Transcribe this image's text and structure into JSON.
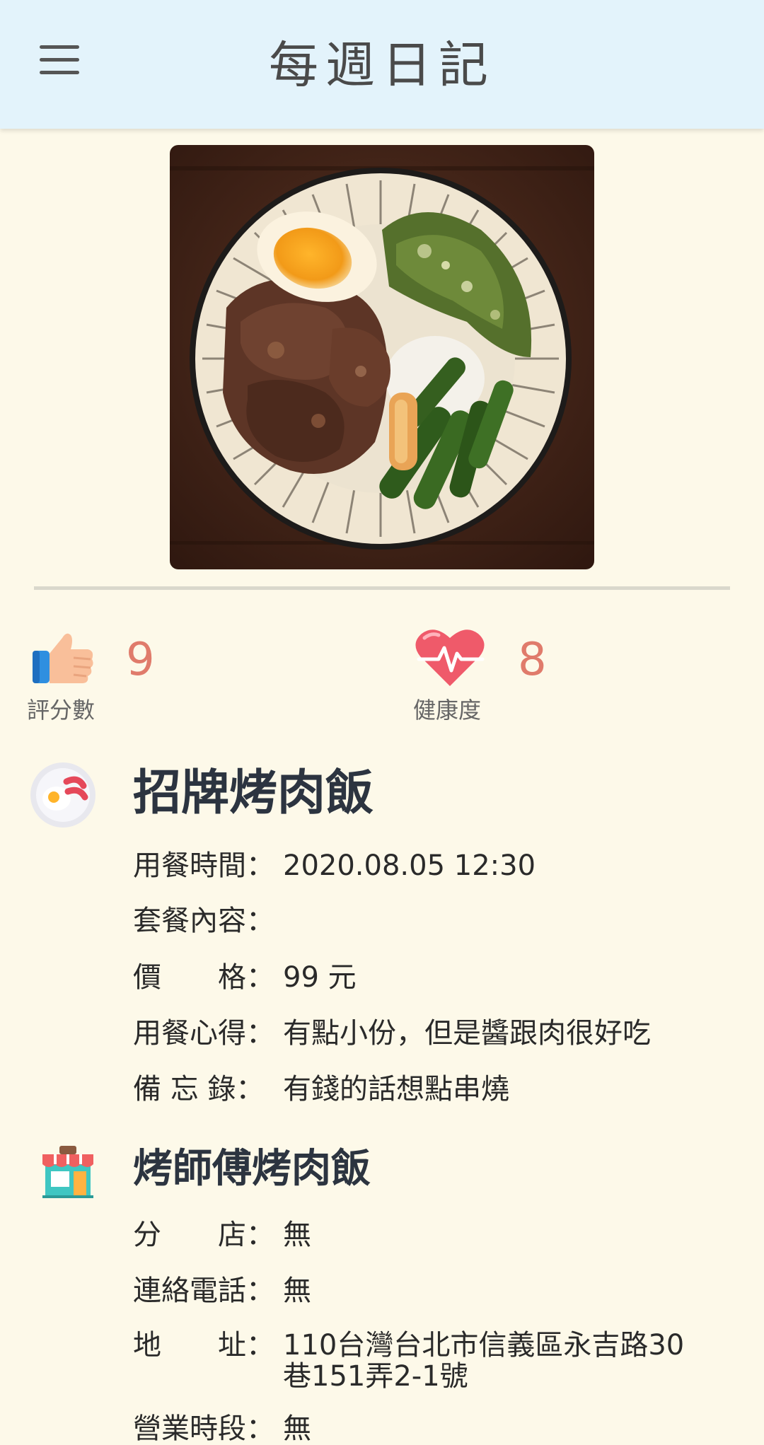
{
  "app_bar": {
    "title": "每週日記",
    "menu_icon": "hamburger-menu-icon"
  },
  "photo": {
    "alt": "招牌烤肉飯",
    "colors": {
      "wood": "#3b1f14",
      "bowl": "#efe4cf",
      "meat": "#5b3426",
      "greens": "#3c6b23",
      "egg": "#f3a51d"
    }
  },
  "stats": {
    "rating": {
      "icon": "thumbs-up-icon",
      "value": "9",
      "label": "評分數"
    },
    "health": {
      "icon": "heartbeat-heart-icon",
      "value": "8",
      "label": "健康度"
    }
  },
  "meal": {
    "icon": "fried-egg-sausage-plate-icon",
    "title": "招牌烤肉飯",
    "rows": [
      {
        "label": "用餐時間：",
        "value": "2020.08.05 12:30"
      },
      {
        "label": "套餐內容：",
        "value": ""
      },
      {
        "label": "價　　格：",
        "value": "99 元"
      },
      {
        "label": "用餐心得：",
        "value": "有點小份，但是醬跟肉很好吃"
      },
      {
        "label": "備 忘 錄：",
        "value": "有錢的話想點串燒"
      }
    ]
  },
  "shop": {
    "icon": "storefront-icon",
    "title": "烤師傅烤肉飯",
    "rows": [
      {
        "label": "分　　店：",
        "value": "無"
      },
      {
        "label": "連絡電話：",
        "value": "無"
      },
      {
        "label": "地　　址：",
        "value": "110台灣台北市信義區永吉路30巷151弄2-1號"
      },
      {
        "label": "營業時段：",
        "value": "無"
      }
    ]
  },
  "accent_color": "#e07b6b",
  "header_color": "#e3f3fb",
  "background_color": "#fdf9e9"
}
